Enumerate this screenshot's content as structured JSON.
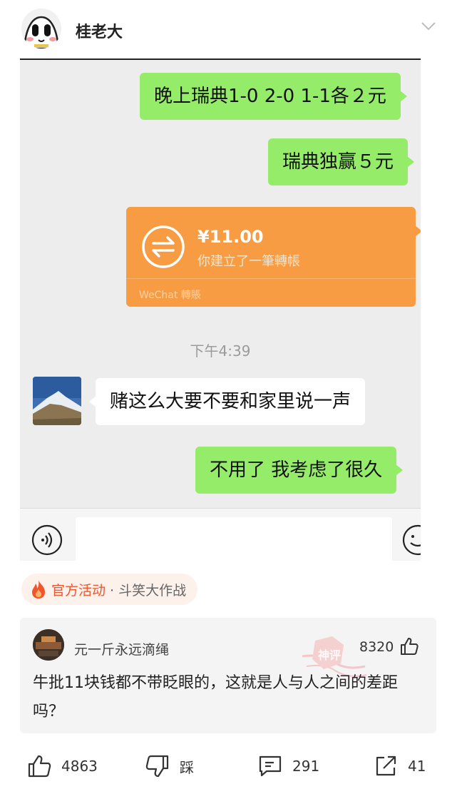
{
  "post": {
    "author": "桂老大"
  },
  "chat": {
    "messages": [
      {
        "side": "right",
        "text": "晚上瑞典1-0 2-0 1-1各２元"
      },
      {
        "side": "right",
        "text": "瑞典独赢５元"
      },
      {
        "side": "left",
        "text": "赌这么大要不要和家里说一声"
      },
      {
        "side": "right",
        "text": "不用了 我考虑了很久"
      }
    ],
    "transfer": {
      "amount": "¥11.00",
      "description": "你建立了一筆轉帳",
      "brand": "WeChat 轉賬"
    },
    "timestamp": "下午4:39"
  },
  "activity": {
    "label": "官方活动",
    "sub": "· 斗笑大作战"
  },
  "top_comment": {
    "user": "元一斤永远滴绳",
    "likes": "8320",
    "text": "牛批11块钱都不带眨眼的，这就是人与人之间的差距吗？",
    "stamp": "神评"
  },
  "actions": {
    "like": "4863",
    "dislike": "踩",
    "comments": "291",
    "share": "41"
  },
  "colors": {
    "bubble_green": "#95ec69",
    "transfer_orange": "#f79c43",
    "activity_red": "#f2552c"
  }
}
